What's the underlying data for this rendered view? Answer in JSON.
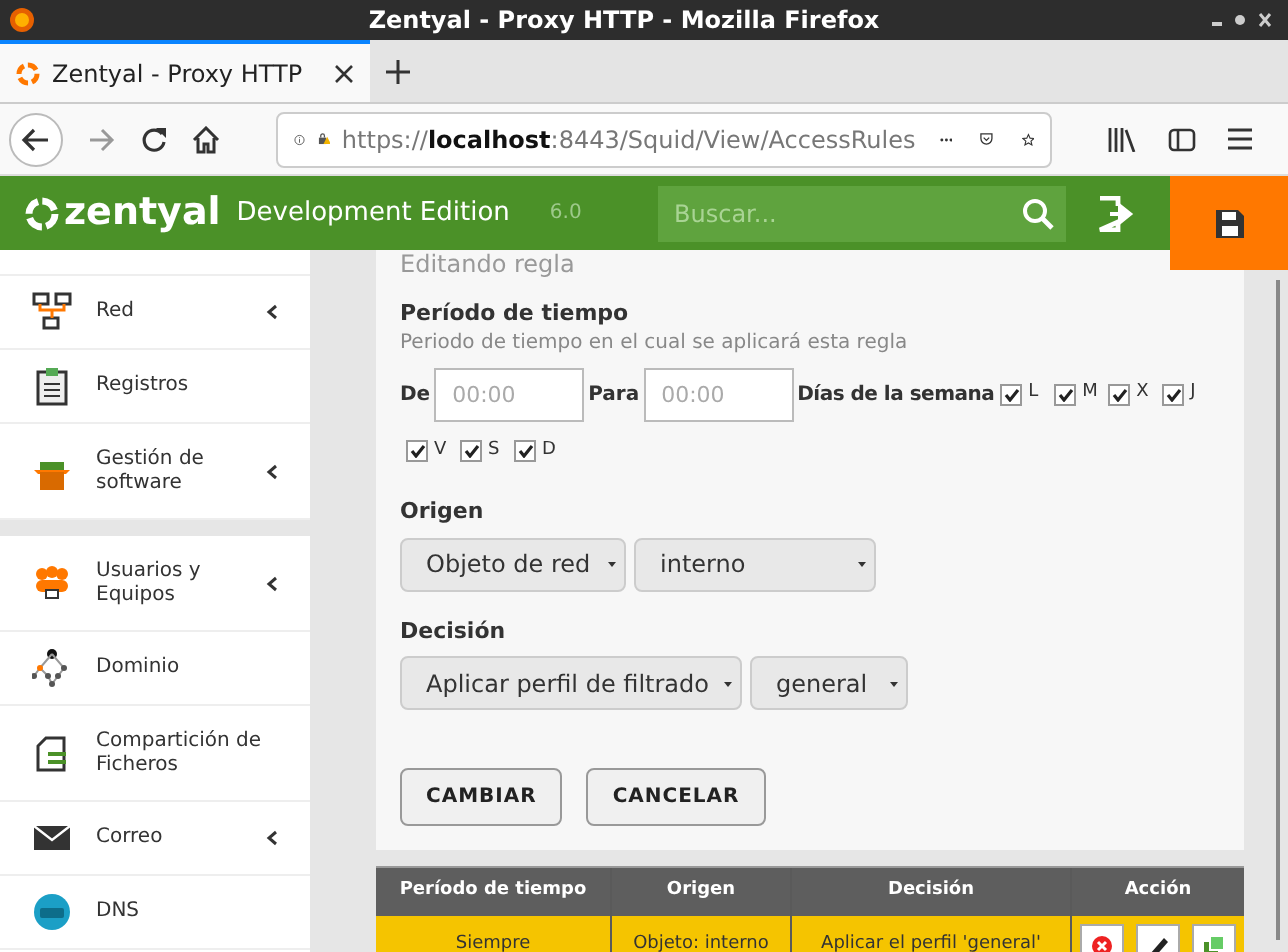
{
  "window": {
    "title": "Zentyal - Proxy HTTP - Mozilla Firefox"
  },
  "tabs": [
    {
      "label": "Zentyal - Proxy HTTP",
      "selected": true
    }
  ],
  "address_bar": {
    "prefix": "https://",
    "host": "localhost",
    "path": ":8443/Squid/View/AccessRules"
  },
  "header": {
    "brand": "zentyal",
    "edition": "Development Edition",
    "version": "6.0",
    "search": {
      "placeholder": "Buscar..."
    }
  },
  "sidebar": {
    "items": [
      {
        "label": "Red",
        "expandable": true
      },
      {
        "label": "Registros",
        "expandable": false
      },
      {
        "label": "Gestión de software",
        "expandable": true,
        "group_end": true
      },
      {
        "label": "Usuarios y Equipos",
        "expandable": true
      },
      {
        "label": "Dominio",
        "expandable": false
      },
      {
        "label": "Compartición de Ficheros",
        "expandable": false
      },
      {
        "label": "Correo",
        "expandable": true
      },
      {
        "label": "DNS",
        "expandable": false
      }
    ]
  },
  "form": {
    "title": "Editando regla",
    "period": {
      "label": "Período de tiempo",
      "help": "Periodo de tiempo en el cual se aplicará esta regla",
      "from_label": "De",
      "from_placeholder": "00:00",
      "to_label": "Para",
      "to_placeholder": "00:00",
      "days_label": "Días de la semana",
      "days": [
        {
          "label": "L",
          "checked": true
        },
        {
          "label": "M",
          "checked": true
        },
        {
          "label": "X",
          "checked": true
        },
        {
          "label": "J",
          "checked": true
        },
        {
          "label": "V",
          "checked": true
        },
        {
          "label": "S",
          "checked": true
        },
        {
          "label": "D",
          "checked": true
        }
      ]
    },
    "origin": {
      "label": "Origen",
      "type": "Objeto de red",
      "value": "interno"
    },
    "decision": {
      "label": "Decisión",
      "type": "Aplicar perfil de filtrado",
      "value": "general"
    },
    "buttons": [
      "CAMBIAR",
      "CANCELAR"
    ]
  },
  "table": {
    "columns": [
      "Período de tiempo",
      "Origen",
      "Decisión",
      "Acción"
    ],
    "rows": [
      {
        "cells": [
          "Siempre",
          "Objeto: interno",
          "Aplicar el perfil 'general'"
        ]
      }
    ]
  }
}
